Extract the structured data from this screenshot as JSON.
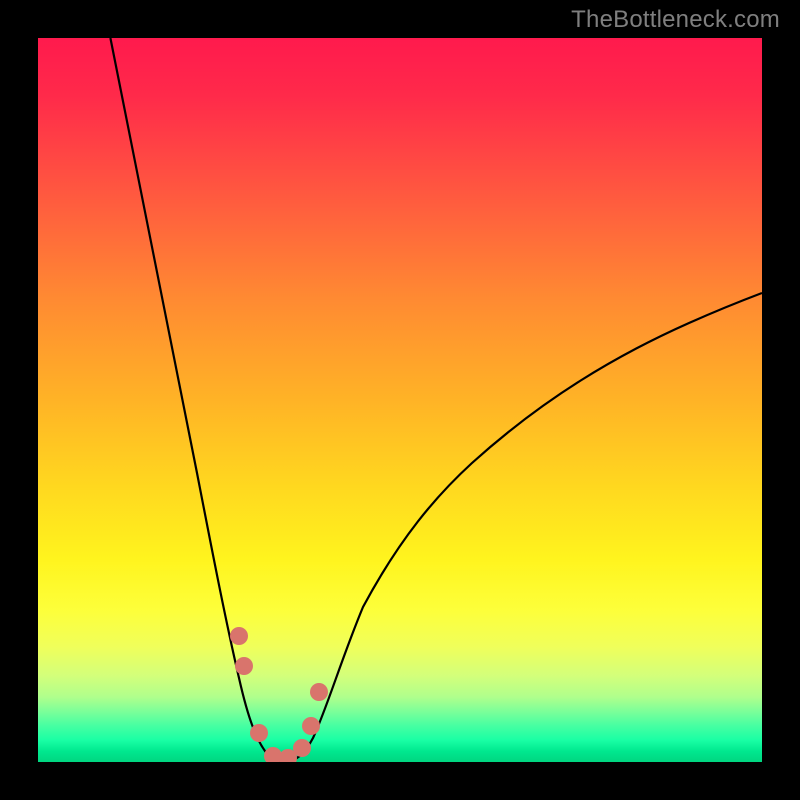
{
  "watermark": "TheBottleneck.com",
  "colors": {
    "frame": "#000000",
    "curve": "#000000",
    "marker": "#d9746c",
    "watermark": "#7f7f7f"
  },
  "chart_data": {
    "type": "line",
    "title": "",
    "xlabel": "",
    "ylabel": "",
    "xlim": [
      0,
      100
    ],
    "ylim": [
      0,
      100
    ],
    "grid": false,
    "legend": false,
    "note": "Bottleneck-style V-curve. Y encodes bottleneck severity (also shown by background gradient: green=low near 0, red=high near 100). Minimum sits around x≈33 with near-zero y; left branch rises steeply to ~100 at x≈10, right branch rises more gradually to ~55 at x=100.",
    "series": [
      {
        "name": "bottleneck-curve",
        "x": [
          10,
          12,
          14,
          16,
          18,
          20,
          22,
          24,
          26,
          27,
          28,
          29,
          30,
          31,
          32,
          33,
          34,
          35,
          36,
          37,
          38,
          40,
          42,
          45,
          50,
          55,
          60,
          65,
          70,
          75,
          80,
          85,
          90,
          95,
          100
        ],
        "y": [
          100,
          90,
          80,
          70,
          61,
          52,
          43,
          34,
          25,
          21,
          17,
          13,
          9,
          6,
          3,
          1,
          0.5,
          0.5,
          1,
          2,
          4,
          8,
          12,
          17,
          23,
          28,
          32,
          36,
          39,
          42,
          45,
          48,
          50,
          53,
          55
        ]
      }
    ],
    "markers": {
      "name": "highlight-near-minimum",
      "x": [
        27.8,
        28.5,
        30.5,
        32.5,
        34.5,
        36.5,
        37.7,
        38.8
      ],
      "y": [
        18,
        14,
        4,
        0.8,
        0.6,
        2,
        5,
        10
      ]
    }
  }
}
